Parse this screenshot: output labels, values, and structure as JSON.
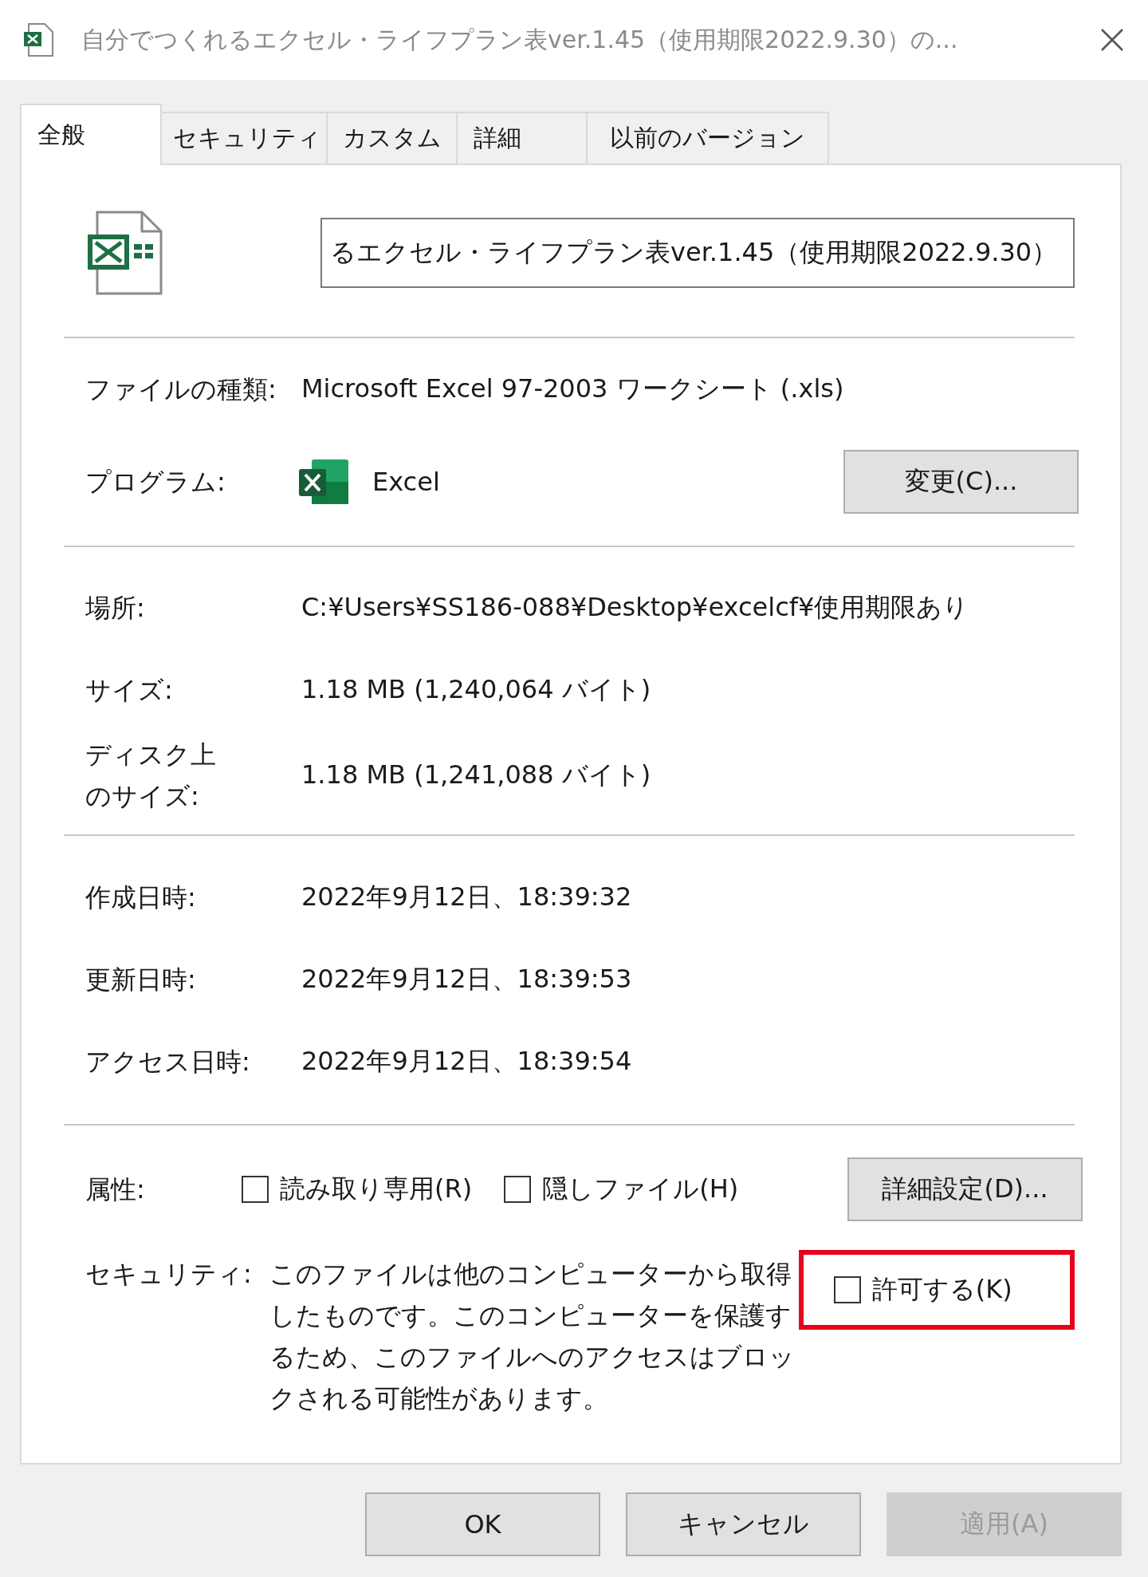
{
  "window": {
    "title": "自分でつくれるエクセル・ライフプラン表ver.1.45（使用期限2022.9.30）の..."
  },
  "tabs": [
    {
      "label": "全般",
      "selected": true
    },
    {
      "label": "セキュリティ",
      "selected": false
    },
    {
      "label": "カスタム",
      "selected": false
    },
    {
      "label": "詳細",
      "selected": false
    },
    {
      "label": "以前のバージョン",
      "selected": false
    }
  ],
  "file_name": {
    "value": "るエクセル・ライフプラン表ver.1.45（使用期限2022.9.30）"
  },
  "sections": [
    {
      "rows": [
        {
          "kind": "text",
          "label": "ファイルの種類:",
          "value": "Microsoft Excel 97-2003 ワークシート (.xls)"
        },
        {
          "kind": "program",
          "label": "プログラム:",
          "value": "Excel",
          "button": "変更(C)..."
        }
      ]
    },
    {
      "rows": [
        {
          "kind": "text",
          "label": "場所:",
          "value": "C:¥Users¥SS186-088¥Desktop¥excelcf¥使用期限あり"
        },
        {
          "kind": "text",
          "label": "サイズ:",
          "value": "1.18 MB (1,240,064 バイト)"
        },
        {
          "kind": "text",
          "label": "ディスク上のサイズ:",
          "value": "1.18 MB (1,241,088 バイト)"
        }
      ]
    },
    {
      "rows": [
        {
          "kind": "text",
          "label": "作成日時:",
          "value": "2022年9月12日、18:39:32"
        },
        {
          "kind": "text",
          "label": "更新日時:",
          "value": "2022年9月12日、18:39:53"
        },
        {
          "kind": "text",
          "label": "アクセス日時:",
          "value": "2022年9月12日、18:39:54"
        }
      ]
    }
  ],
  "attributes": {
    "label": "属性:",
    "checkboxes": [
      {
        "label": "読み取り専用(R)",
        "checked": false
      },
      {
        "label": "隠しファイル(H)",
        "checked": false
      }
    ],
    "button": "詳細設定(D)..."
  },
  "security": {
    "label": "セキュリティ:",
    "text": "このファイルは他のコンピューターから取得したものです。このコンピューターを保護するため、このファイルへのアクセスはブロックされる可能性があります。",
    "checkbox": {
      "label": "許可する(K)",
      "checked": false,
      "highlighted": true
    }
  },
  "buttons": [
    {
      "label": "OK",
      "disabled": false
    },
    {
      "label": "キャンセル",
      "disabled": false
    },
    {
      "label": "適用(A)",
      "disabled": true
    }
  ]
}
